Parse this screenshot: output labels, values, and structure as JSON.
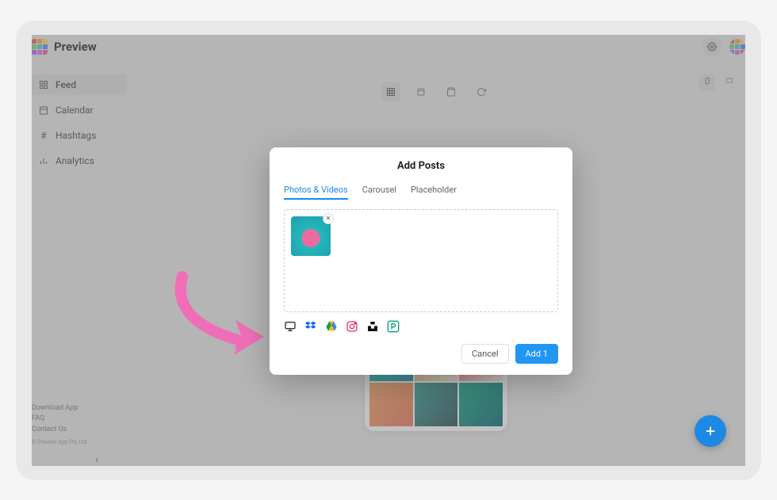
{
  "brand": {
    "name": "Preview"
  },
  "sidebar": {
    "items": [
      {
        "label": "Feed"
      },
      {
        "label": "Calendar"
      },
      {
        "label": "Hashtags"
      },
      {
        "label": "Analytics"
      }
    ],
    "footer": {
      "download": "Download App",
      "faq": "FAQ",
      "contact": "Contact Us",
      "copyright": "© Preview App Pty Ltd"
    }
  },
  "modal": {
    "title": "Add Posts",
    "tabs": [
      {
        "label": "Photos & Videos"
      },
      {
        "label": "Carousel"
      },
      {
        "label": "Placeholder"
      }
    ],
    "actions": {
      "cancel": "Cancel",
      "add": "Add 1"
    },
    "upload_sources": [
      "computer",
      "dropbox",
      "google-drive",
      "instagram",
      "unsplash",
      "pexels"
    ]
  },
  "colors": {
    "primary": "#2196f3",
    "arrow": "#f06eb8",
    "logo": [
      "#f15a5a",
      "#f7a14b",
      "#f7d84b",
      "#7bd271",
      "#4bc6d8",
      "#4b8cf7",
      "#9f6bf2",
      "#e66be6",
      "#f15a9d"
    ]
  }
}
